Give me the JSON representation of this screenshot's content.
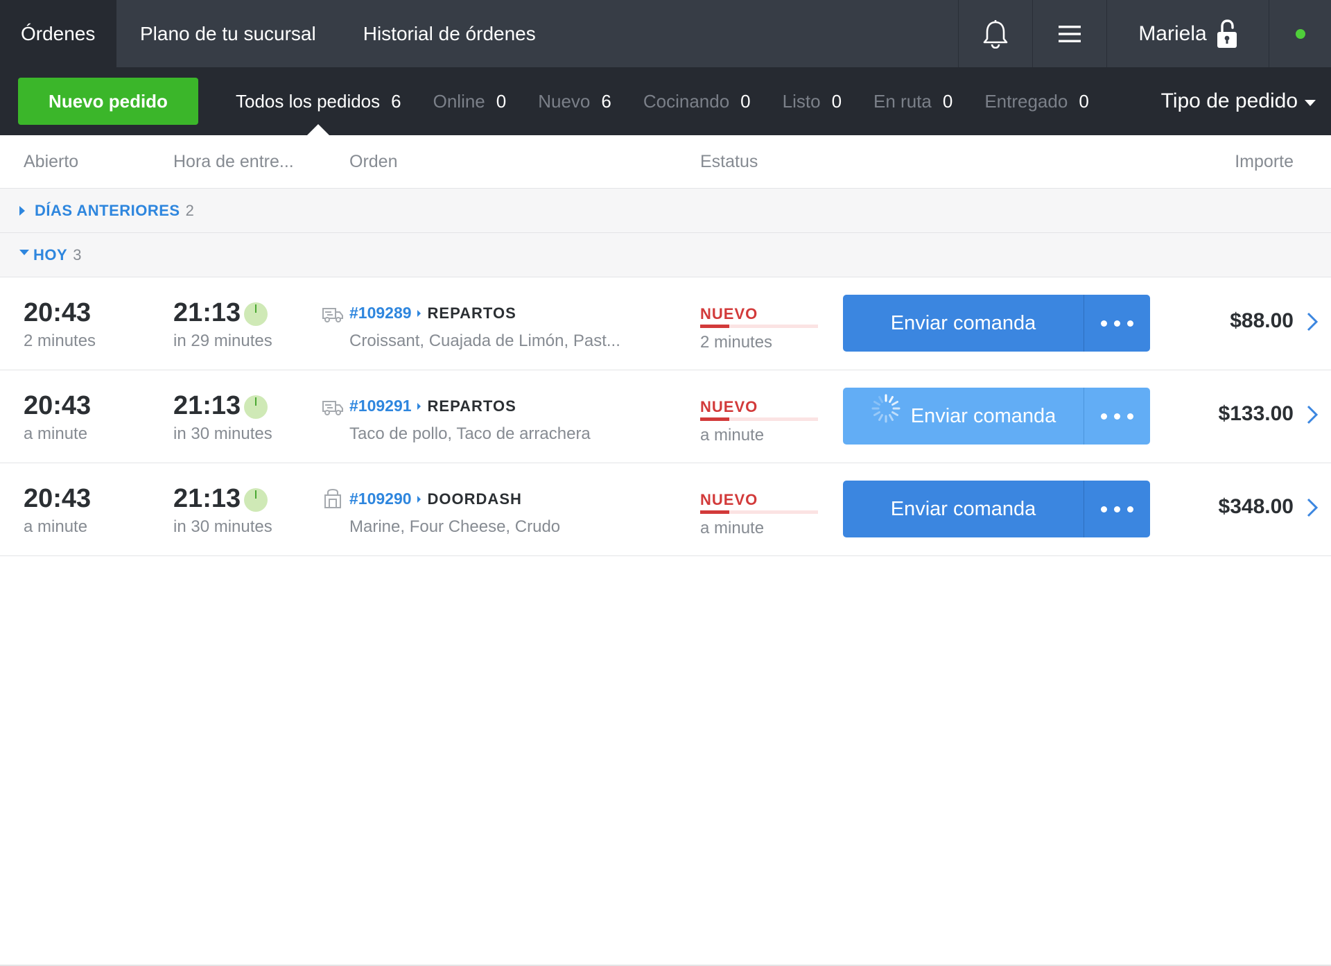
{
  "topnav": {
    "tabs": [
      {
        "label": "Órdenes",
        "active": true
      },
      {
        "label": "Plano de tu sucursal",
        "active": false
      },
      {
        "label": "Historial de órdenes",
        "active": false
      }
    ],
    "user_name": "Mariela",
    "icons": {
      "notifications": "bell-icon",
      "menu": "hamburger-icon",
      "lock": "unlock-icon",
      "status": "online-dot"
    }
  },
  "filterbar": {
    "new_order_label": "Nuevo pedido",
    "tabs": [
      {
        "label": "Todos los pedidos",
        "count": "6",
        "active": true
      },
      {
        "label": "Online",
        "count": "0",
        "active": false
      },
      {
        "label": "Nuevo",
        "count": "6",
        "active": false
      },
      {
        "label": "Cocinando",
        "count": "0",
        "active": false
      },
      {
        "label": "Listo",
        "count": "0",
        "active": false
      },
      {
        "label": "En ruta",
        "count": "0",
        "active": false
      },
      {
        "label": "Entregado",
        "count": "0",
        "active": false
      }
    ],
    "order_type_label": "Tipo de pedido"
  },
  "columns": {
    "opened": "Abierto",
    "delivery_time": "Hora de entre...",
    "order": "Orden",
    "status": "Estatus",
    "amount": "Importe"
  },
  "groups": {
    "previous": {
      "label": "DÍAS ANTERIORES",
      "count": "2",
      "expanded": false
    },
    "today": {
      "label": "HOY",
      "count": "3",
      "expanded": true
    }
  },
  "orders": [
    {
      "opened_time": "20:43",
      "opened_ago": "2 minutes",
      "delivery_time": "21:13",
      "delivery_in": "in 29 minutes",
      "type_icon": "delivery-truck-icon",
      "id": "#109289",
      "source": "REPARTOS",
      "items": "Croissant, Cuajada de Limón, Past...",
      "status": "NUEVO",
      "status_ago": "2 minutes",
      "action_label": "Enviar comanda",
      "loading": false,
      "amount": "$88.00"
    },
    {
      "opened_time": "20:43",
      "opened_ago": "a minute",
      "delivery_time": "21:13",
      "delivery_in": "in 30 minutes",
      "type_icon": "delivery-truck-icon",
      "id": "#109291",
      "source": "REPARTOS",
      "items": "Taco de pollo, Taco de arrachera",
      "status": "NUEVO",
      "status_ago": "a minute",
      "action_label": "Enviar comanda",
      "loading": true,
      "amount": "$133.00"
    },
    {
      "opened_time": "20:43",
      "opened_ago": "a minute",
      "delivery_time": "21:13",
      "delivery_in": "in 30 minutes",
      "type_icon": "takeout-bag-icon",
      "id": "#109290",
      "source": "DOORDASH",
      "items": "Marine, Four Cheese, Crudo",
      "status": "NUEVO",
      "status_ago": "a minute",
      "action_label": "Enviar comanda",
      "loading": false,
      "amount": "$348.00"
    }
  ],
  "colors": {
    "topbar": "#373d46",
    "filterbar": "#262a31",
    "accent_blue": "#3b86e0",
    "new_order_green": "#3bb62a",
    "status_red": "#d23a3a",
    "online_green": "#4fcf3a"
  }
}
